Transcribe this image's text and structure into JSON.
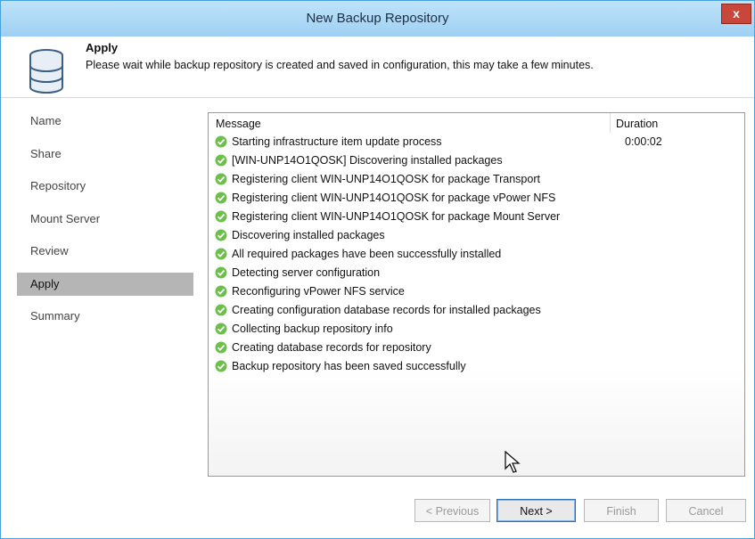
{
  "window": {
    "title": "New Backup Repository",
    "close_label": "x"
  },
  "header": {
    "step_title": "Apply",
    "description": "Please wait while backup repository is created and saved in configuration, this may take a few minutes."
  },
  "sidebar": {
    "items": [
      {
        "label": "Name"
      },
      {
        "label": "Share"
      },
      {
        "label": "Repository"
      },
      {
        "label": "Mount Server"
      },
      {
        "label": "Review"
      },
      {
        "label": "Apply"
      },
      {
        "label": "Summary"
      }
    ],
    "active": "Apply"
  },
  "log": {
    "columns": {
      "message": "Message",
      "duration": "Duration"
    },
    "rows": [
      {
        "message": "Starting infrastructure item update process",
        "duration": "0:00:02"
      },
      {
        "message": "[WIN-UNP14O1QOSK] Discovering installed packages"
      },
      {
        "message": "Registering client WIN-UNP14O1QOSK for package Transport"
      },
      {
        "message": "Registering client WIN-UNP14O1QOSK for package vPower NFS"
      },
      {
        "message": "Registering client WIN-UNP14O1QOSK for package Mount Server"
      },
      {
        "message": "Discovering installed packages"
      },
      {
        "message": "All required packages have been successfully installed"
      },
      {
        "message": "Detecting server configuration"
      },
      {
        "message": "Reconfiguring vPower NFS service"
      },
      {
        "message": "Creating configuration database records for installed packages"
      },
      {
        "message": "Collecting backup repository info"
      },
      {
        "message": "Creating database records for repository"
      },
      {
        "message": "Backup repository has been saved successfully"
      }
    ],
    "status_icon": "success-check-icon",
    "status_color": "#6cbf4a"
  },
  "buttons": {
    "previous": "< Previous",
    "next": "Next >",
    "finish": "Finish",
    "cancel": "Cancel"
  }
}
